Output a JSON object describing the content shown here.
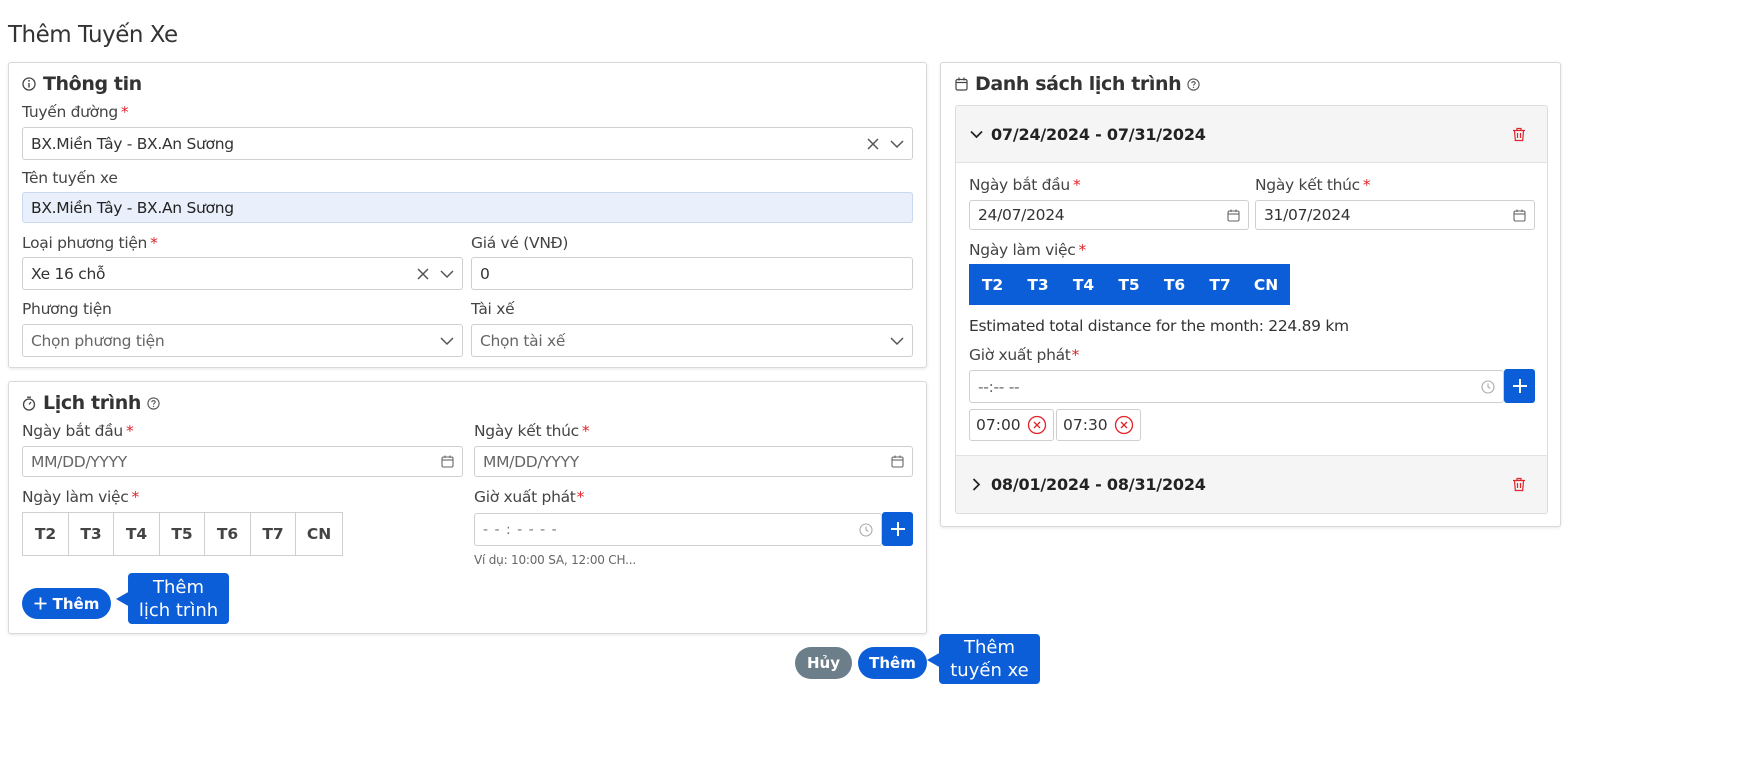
{
  "page_title": "Thêm Tuyến Xe",
  "info": {
    "title": "Thông tin",
    "route_label": "Tuyến đường",
    "route_value": "BX.Miền Tây - BX.An Sương",
    "name_label": "Tên tuyến xe",
    "name_value": "BX.Miền Tây - BX.An Sương",
    "vehicle_type_label": "Loại phương tiện",
    "vehicle_type_value": "Xe 16 chỗ",
    "price_label": "Giá vé (VNĐ)",
    "price_value": "0",
    "vehicle_label": "Phương tiện",
    "vehicle_placeholder": "Chọn phương tiện",
    "driver_label": "Tài xế",
    "driver_placeholder": "Chọn tài xế"
  },
  "schedule": {
    "title": "Lịch trình",
    "start_label": "Ngày bắt đầu",
    "start_placeholder": "MM/DD/YYYY",
    "end_label": "Ngày kết thúc",
    "end_placeholder": "MM/DD/YYYY",
    "workdays_label": "Ngày làm việc",
    "days": [
      "T2",
      "T3",
      "T4",
      "T5",
      "T6",
      "T7",
      "CN"
    ],
    "depart_label": "Giờ xuất phát",
    "depart_placeholder": "- - : - -   - -",
    "hint": "Ví dụ: 10:00 SA, 12:00 CH...",
    "add_button": "Thêm",
    "add_tooltip_line1": "Thêm",
    "add_tooltip_line2": "lịch trình"
  },
  "list": {
    "title": "Danh sách lịch trình",
    "item1": {
      "range": "07/24/2024 - 07/31/2024",
      "start_label": "Ngày bắt đầu",
      "start_value": "24/07/2024",
      "end_label": "Ngày kết thúc",
      "end_value": "31/07/2024",
      "workdays_label": "Ngày làm việc",
      "days": [
        "T2",
        "T3",
        "T4",
        "T5",
        "T6",
        "T7",
        "CN"
      ],
      "distance_text": "Estimated total distance for the month: 224.89 km",
      "depart_label": "Giờ xuất phát",
      "depart_placeholder": "--:-- --",
      "times": [
        "07:00",
        "07:30"
      ]
    },
    "item2": {
      "range": "08/01/2024 - 08/31/2024"
    }
  },
  "footer": {
    "cancel": "Hủy",
    "submit": "Thêm",
    "tooltip_line1": "Thêm",
    "tooltip_line2": "tuyến xe"
  },
  "colors": {
    "primary": "#0b5ed7",
    "cancel": "#6c7e8a",
    "required": "#e0242b",
    "delete": "#e0242b"
  }
}
